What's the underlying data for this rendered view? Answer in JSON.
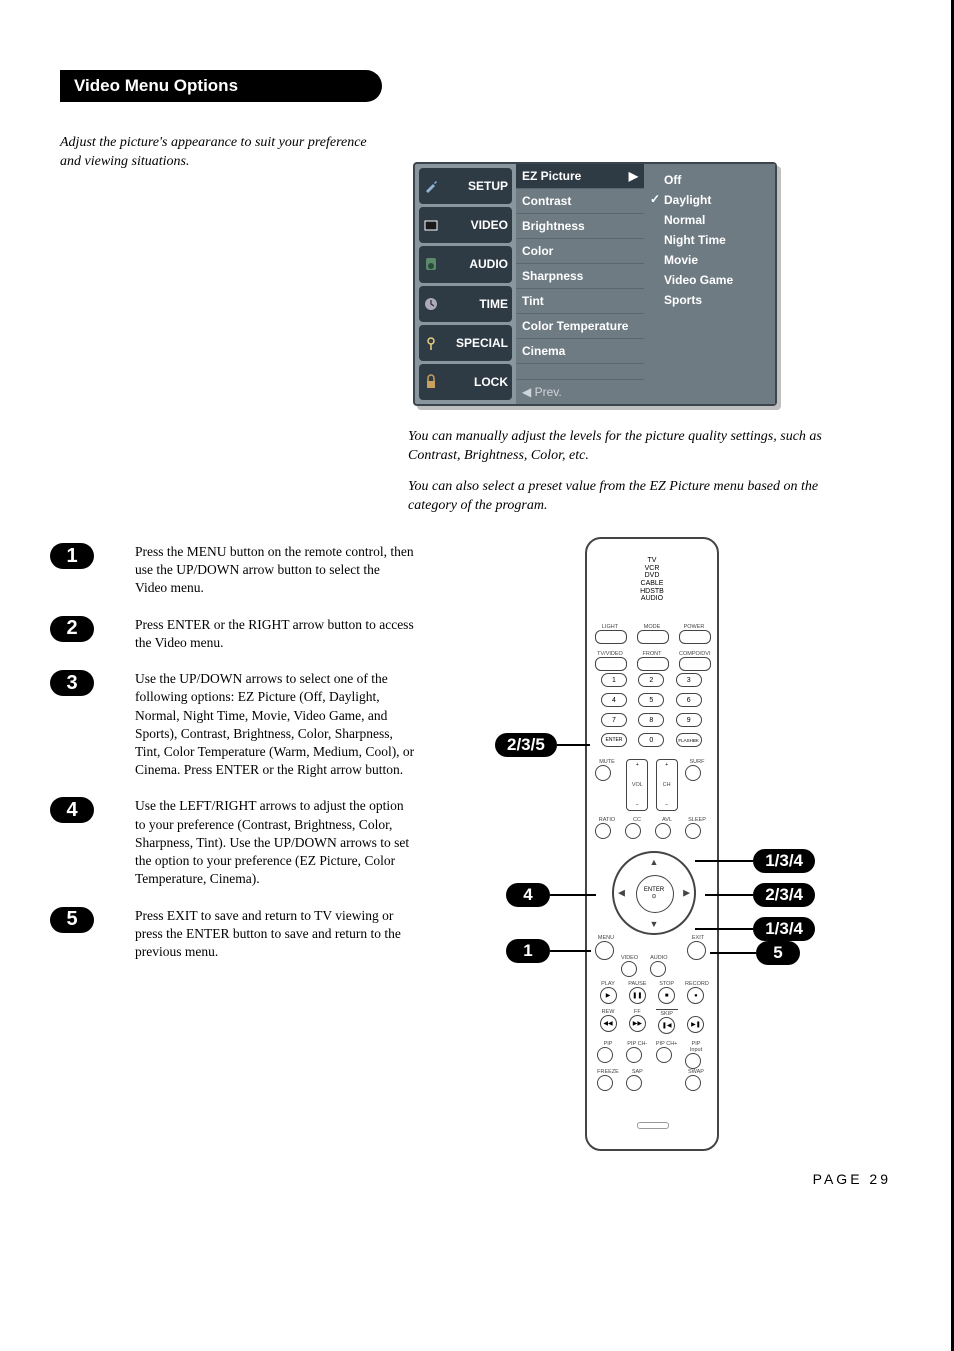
{
  "section_title": "Video Menu Options",
  "intro_text": "Adjust the picture's appearance to suit your preference and viewing situations.",
  "osd": {
    "tabs": [
      "SETUP",
      "VIDEO",
      "AUDIO",
      "TIME",
      "SPECIAL",
      "LOCK"
    ],
    "col2": [
      "EZ Picture",
      "Contrast",
      "Brightness",
      "Color",
      "Sharpness",
      "Tint",
      "Color Temperature",
      "Cinema"
    ],
    "prev_label": "◀ Prev.",
    "arrow_label": "▶",
    "col3": [
      "Off",
      "Daylight",
      "Normal",
      "Night Time",
      "Movie",
      "Video Game",
      "Sports"
    ],
    "selected_col2": "EZ Picture",
    "checked_col3": "Daylight"
  },
  "captions": {
    "p1": "You can manually adjust the levels for the picture quality settings, such as Contrast, Brightness, Color, etc.",
    "p2": "You can also select a preset value from the EZ Picture menu based on the category of the program."
  },
  "steps": [
    {
      "n": "1",
      "text": "Press the MENU button on the remote control, then use the UP/DOWN arrow button to select the Video menu."
    },
    {
      "n": "2",
      "text": "Press ENTER or the RIGHT arrow button to access the Video menu."
    },
    {
      "n": "3",
      "text": "Use the UP/DOWN arrows to select one of the following options: EZ Picture (Off, Daylight, Normal, Night Time, Movie, Video Game, and Sports), Contrast, Brightness, Color, Sharpness, Tint, Color Temperature (Warm, Medium, Cool), or Cinema. Press ENTER or the Right arrow button."
    },
    {
      "n": "4",
      "text": "Use the LEFT/RIGHT arrows to adjust the option to your preference (Contrast, Brightness, Color, Sharpness, Tint). Use the UP/DOWN arrows to set the option to your preference (EZ Picture, Color Temperature, Cinema)."
    },
    {
      "n": "5",
      "text": "Press EXIT to save and return to TV viewing or press the ENTER button to save and return to the previous menu."
    }
  ],
  "remote": {
    "modes": "TV\nVCR\nDVD\nCABLE\nHDSTB\nAUDIO",
    "row1_labels": [
      "LIGHT",
      "MODE",
      "POWER"
    ],
    "row2_labels": [
      "TV/VIDEO",
      "FRONT",
      "COMPO/DVI"
    ],
    "nums": [
      "1",
      "2",
      "3",
      "4",
      "5",
      "6",
      "7",
      "8",
      "9"
    ],
    "bottomrow_labels": [
      "ENTER",
      "0",
      "FLASHBK"
    ],
    "mute": "MUTE",
    "surf": "SURF",
    "vol": "VOL",
    "ch": "CH",
    "ratio": "RATIO",
    "cc": "CC",
    "avl": "AVL",
    "sleep": "SLEEP",
    "enter": "ENTER\n⊙",
    "menu": "MENU",
    "exit": "EXIT",
    "video": "VIDEO",
    "audio": "AUDIO",
    "play": "PLAY",
    "pause": "PAUSE",
    "stop": "STOP",
    "record": "RECORD",
    "rew": "REW",
    "ff": "FF",
    "skip": "SKIP",
    "pip": "PIP",
    "pipchm": "PIP CH-",
    "pipchp": "PIP CH+",
    "pipinput": "PIP Input",
    "freeze": "FREEZE",
    "sap": "SAP",
    "swap": "SWAP",
    "play_sym": "▶",
    "pause_sym": "❚❚",
    "stop_sym": "■",
    "rec_sym": "●",
    "rew_sym": "◀◀",
    "ff_sym": "▶▶",
    "skb_sym": "❚◀",
    "skf_sym": "▶❚"
  },
  "callouts": {
    "left_235": "2/3/5",
    "left_4": "4",
    "left_1": "1",
    "right_134a": "1/3/4",
    "right_234": "2/3/4",
    "right_134b": "1/3/4",
    "right_5": "5"
  },
  "page_number": "PAGE 29"
}
